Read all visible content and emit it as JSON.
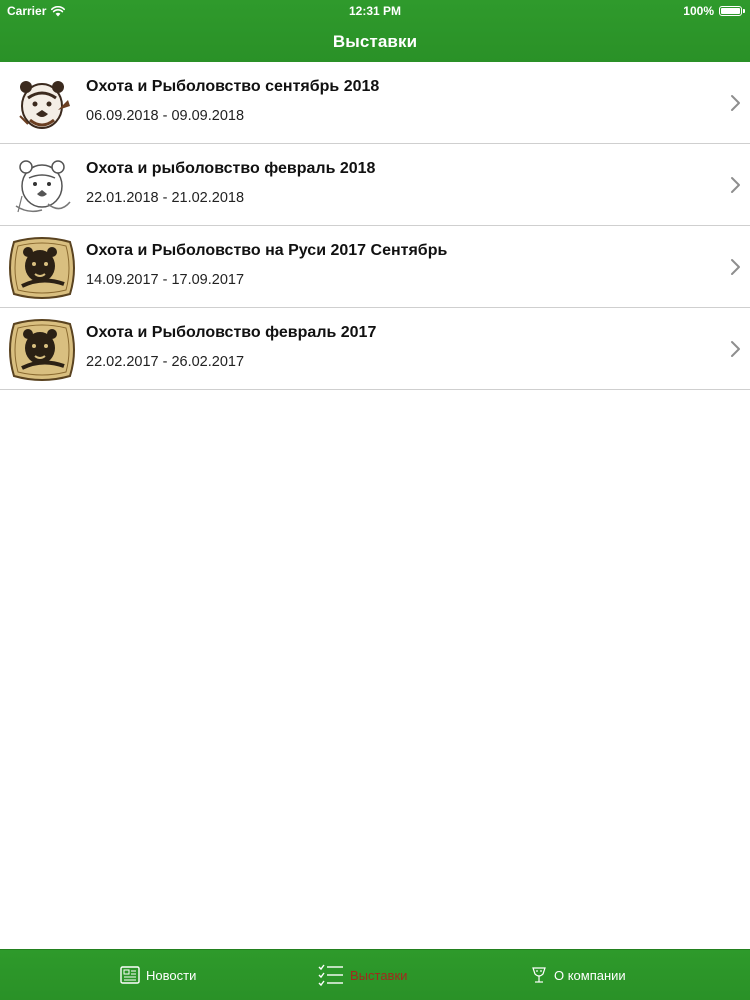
{
  "status_bar": {
    "carrier": "Carrier",
    "time": "12:31 PM",
    "battery": "100%",
    "battery_level": 1.0
  },
  "nav": {
    "title": "Выставки"
  },
  "exhibitions": [
    {
      "title": "Охота и Рыболовство сентябрь 2018",
      "dates": "06.09.2018 - 09.09.2018",
      "icon": "bear-logo-icon"
    },
    {
      "title": "Охота и рыболовство февраль 2018",
      "dates": "22.01.2018 - 21.02.2018",
      "icon": "bear-sketch-icon"
    },
    {
      "title": "Охота и Рыболовство на Руси 2017 Сентябрь",
      "dates": "14.09.2017 - 17.09.2017",
      "icon": "bear-badge-icon"
    },
    {
      "title": "Охота и Рыболовство февраль 2017",
      "dates": "22.02.2017 - 26.02.2017",
      "icon": "bear-badge-icon"
    }
  ],
  "tabbar": {
    "items": [
      {
        "label": "Новости",
        "icon": "newspaper-icon",
        "active": false
      },
      {
        "label": "Выставки",
        "icon": "checklist-icon",
        "active": true
      },
      {
        "label": "О компании",
        "icon": "company-icon",
        "active": false
      }
    ]
  },
  "colors": {
    "brand_green": "#2a9127",
    "active_tab_text": "#a12a1e",
    "badge_gold": "#d9bf80"
  }
}
